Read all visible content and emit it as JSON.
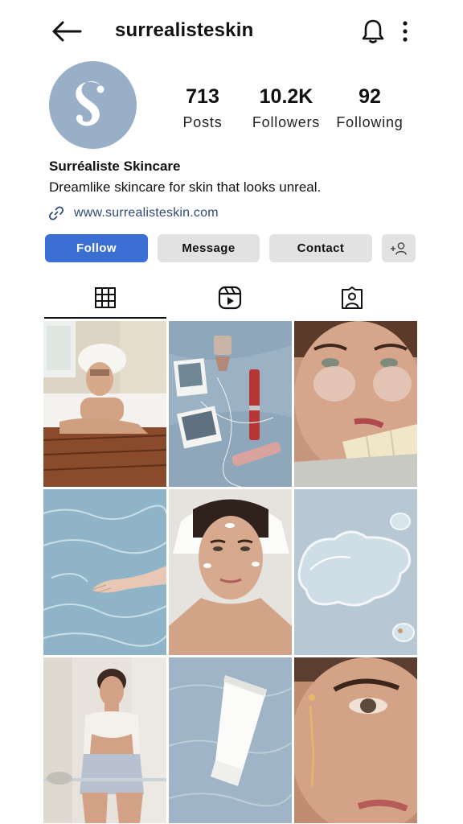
{
  "header": {
    "username": "surrealisteskin",
    "icons": {
      "back": "arrow-left-icon",
      "notifications": "bell-icon",
      "more": "more-vertical-icon"
    }
  },
  "profile": {
    "avatar_letter": "S",
    "display_name": "Surréaliste Skincare",
    "bio": "Dreamlike skincare for skin that looks unreal.",
    "website": "www.surrealisteskin.com",
    "stats": {
      "posts": {
        "value": "713",
        "label": "Posts"
      },
      "followers": {
        "value": "10.2K",
        "label": "Followers"
      },
      "following": {
        "value": "92",
        "label": "Following"
      }
    }
  },
  "actions": {
    "follow": "Follow",
    "message": "Message",
    "contact": "Contact"
  },
  "tabs": [
    {
      "icon": "grid-icon",
      "active": true
    },
    {
      "icon": "reels-icon",
      "active": false
    },
    {
      "icon": "tagged-icon",
      "active": false
    }
  ],
  "colors": {
    "accent": "#3b6fd4",
    "avatar_bg": "#98afc7",
    "button_bg": "#e2e2e2",
    "link": "#2e4a7a"
  },
  "posts": [
    {
      "subject": "woman with towel in bathtub"
    },
    {
      "subject": "skincare flat lay with photos and lipstick"
    },
    {
      "subject": "woman with under-eye patches eating chocolate"
    },
    {
      "subject": "hand in rippling water"
    },
    {
      "subject": "woman with cream on face"
    },
    {
      "subject": "clear gel droplets"
    },
    {
      "subject": "woman applying cream in mirror"
    },
    {
      "subject": "white cream tube on water"
    },
    {
      "subject": "face with serum drop close-up"
    }
  ]
}
